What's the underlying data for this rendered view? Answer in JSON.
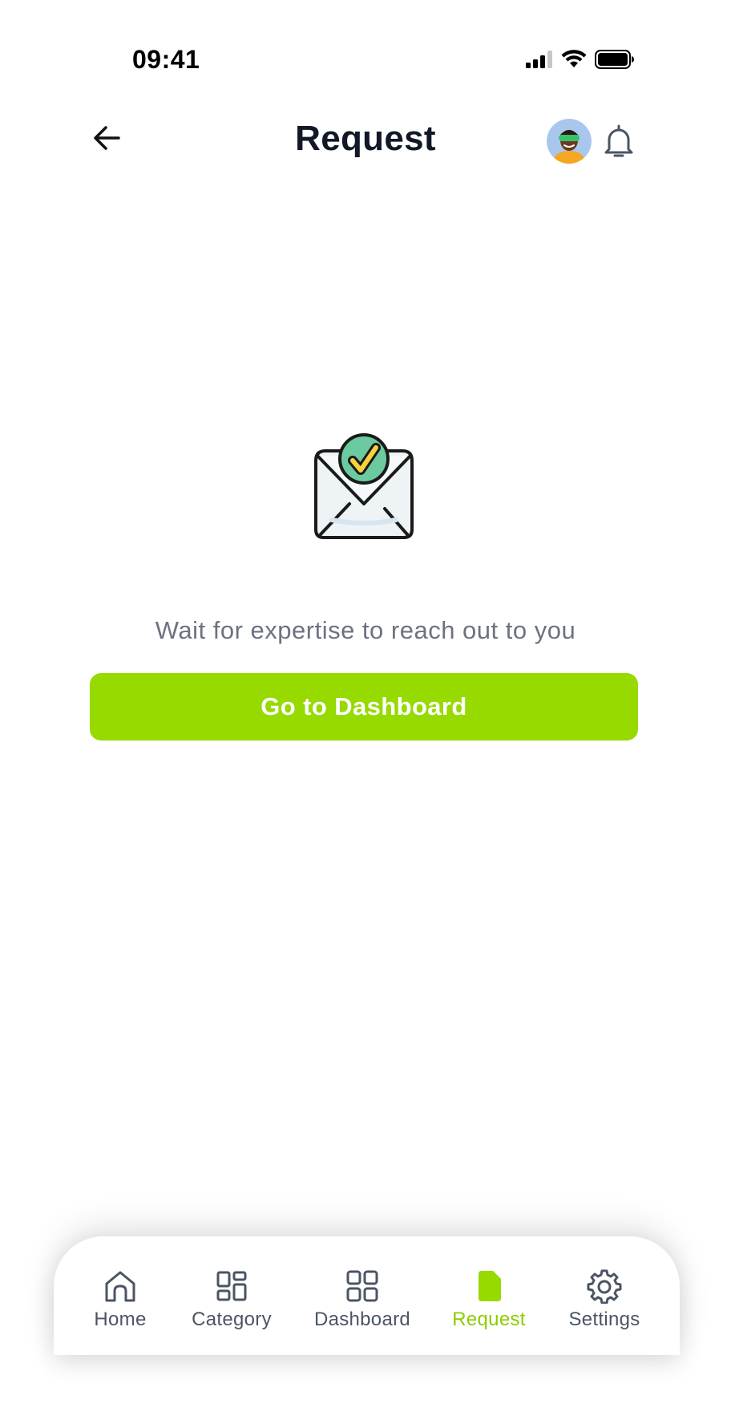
{
  "status_bar": {
    "time": "09:41"
  },
  "header": {
    "title": "Request",
    "back_icon": "arrow-left-icon",
    "bell_icon": "bell-icon"
  },
  "main": {
    "illustration": "envelope-check-icon",
    "message": "Wait for expertise to reach out to  you",
    "cta_label": "Go to Dashboard"
  },
  "tabbar": {
    "items": [
      {
        "label": "Home",
        "icon": "home-icon",
        "active": false
      },
      {
        "label": "Category",
        "icon": "category-icon",
        "active": false
      },
      {
        "label": "Dashboard",
        "icon": "dashboard-icon",
        "active": false
      },
      {
        "label": "Request",
        "icon": "document-icon",
        "active": true
      },
      {
        "label": "Settings",
        "icon": "gear-icon",
        "active": false
      }
    ]
  },
  "colors": {
    "accent": "#96da00",
    "active_tab": "#8ccc00",
    "title": "#111827",
    "muted_text": "#6b7280",
    "tab_icon": "#4b5563"
  }
}
